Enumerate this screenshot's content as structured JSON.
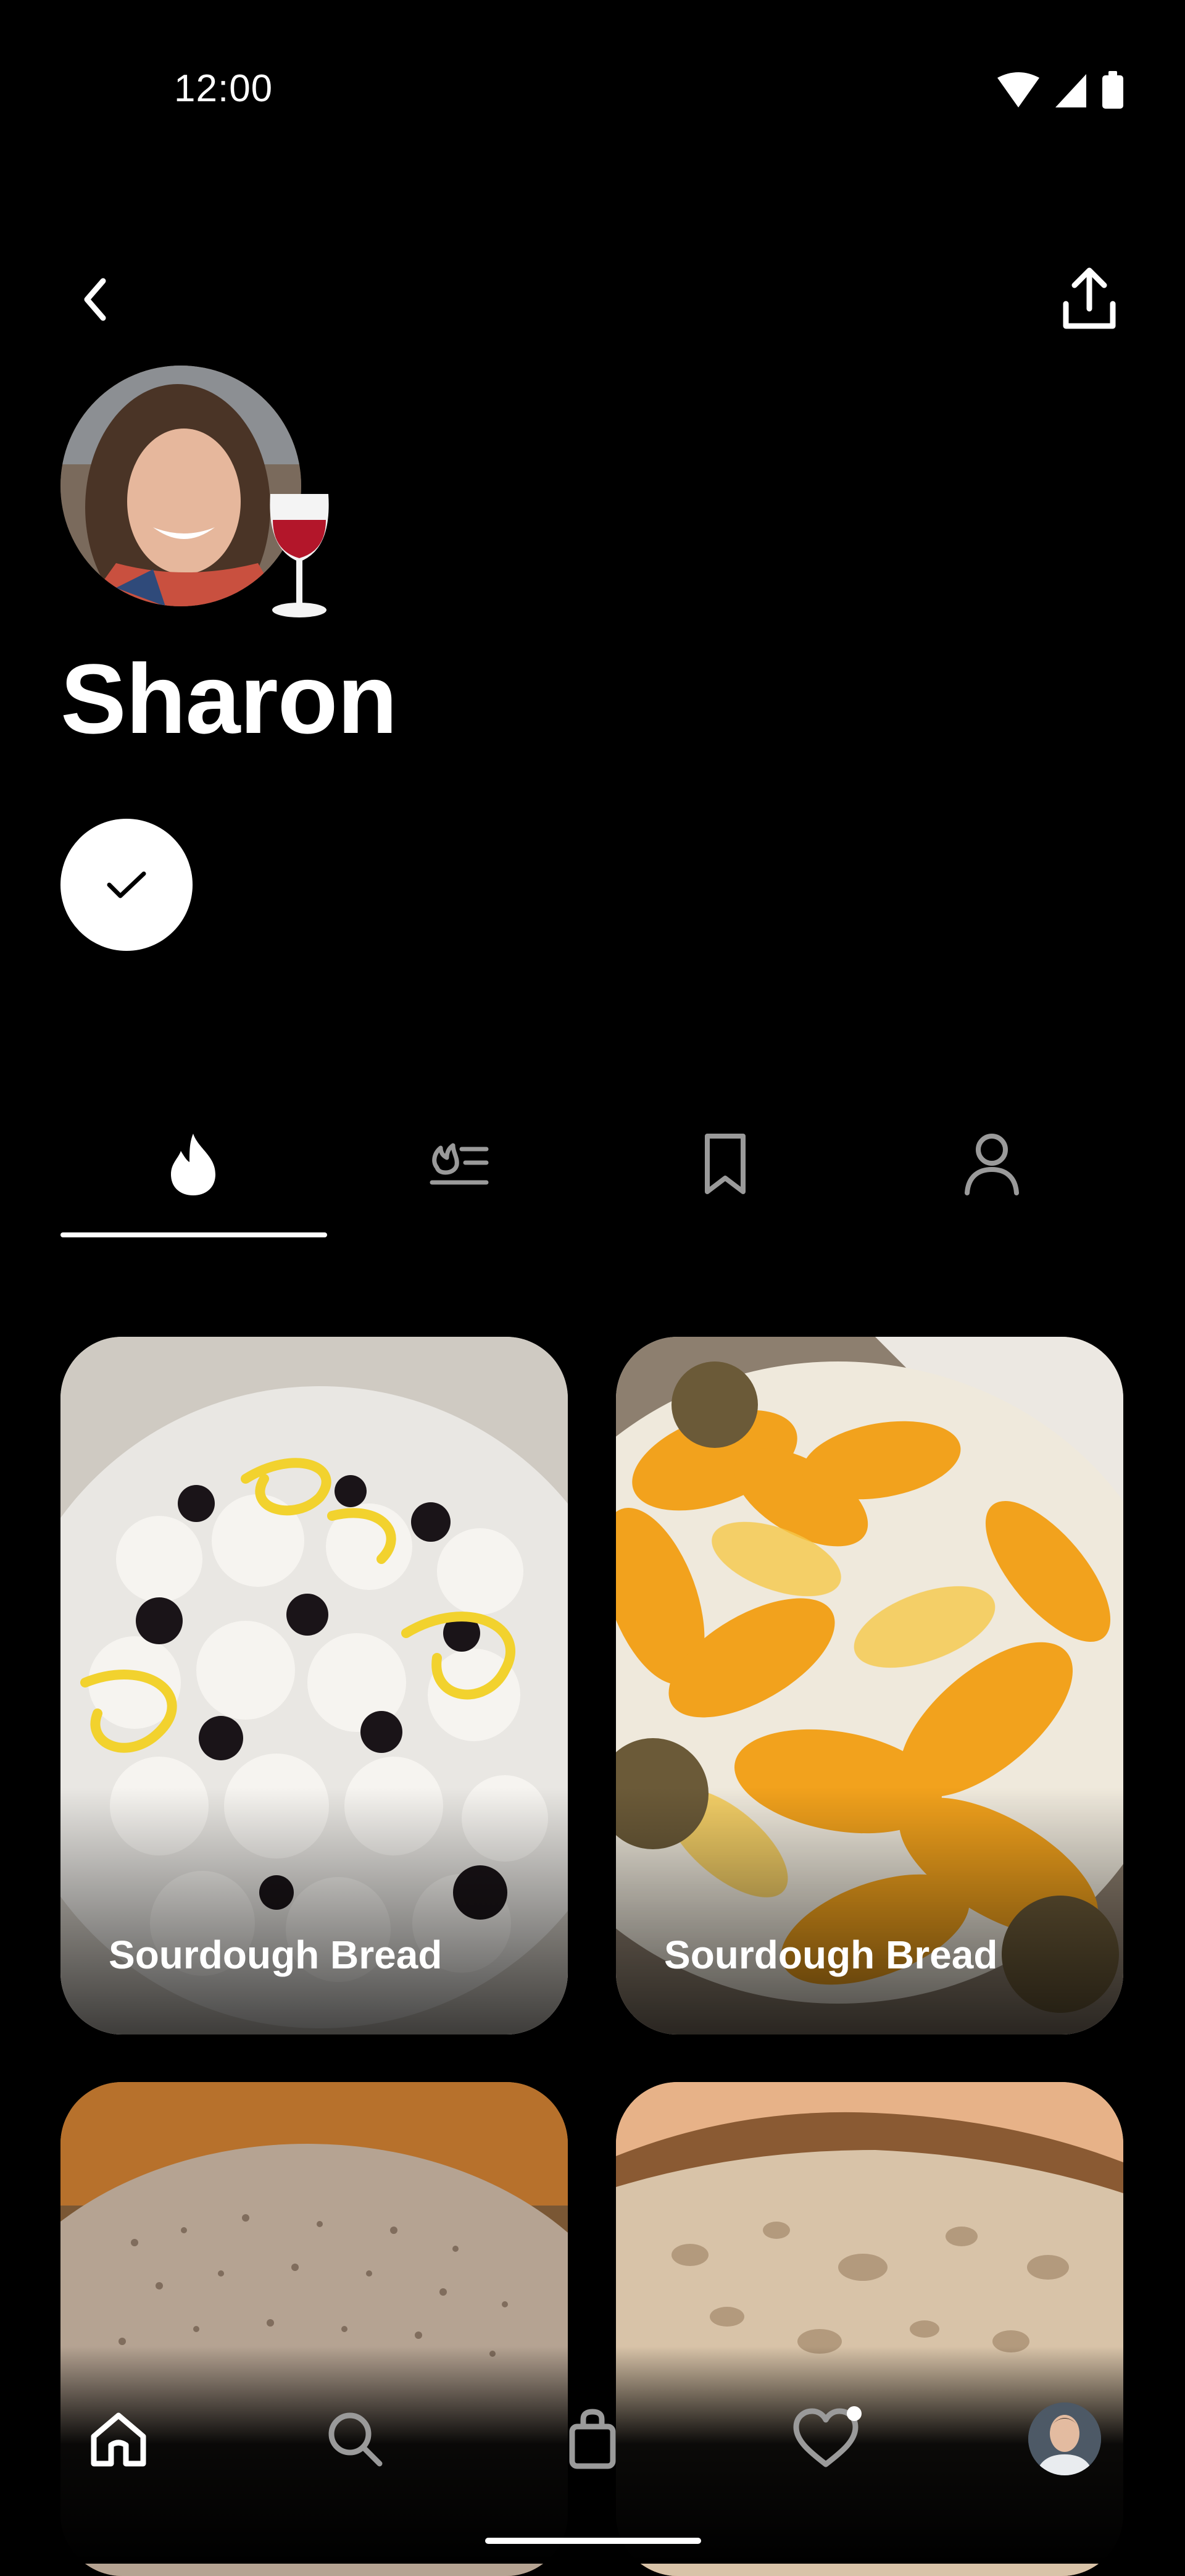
{
  "status_bar": {
    "time": "12:00"
  },
  "profile": {
    "name": "Sharon"
  },
  "tabs": [
    {
      "icon": "flame-icon"
    },
    {
      "icon": "recipes-list-icon"
    },
    {
      "icon": "bookmark-icon"
    },
    {
      "icon": "person-icon"
    }
  ],
  "grid": {
    "items": [
      {
        "title": "Sourdough Bread"
      },
      {
        "title": "Sourdough Bread"
      },
      {
        "title": ""
      },
      {
        "title": ""
      }
    ]
  },
  "bottom_nav": {
    "items": [
      {
        "icon": "home-icon"
      },
      {
        "icon": "search-icon"
      },
      {
        "icon": "shopping-bag-icon"
      },
      {
        "icon": "heart-icon"
      },
      {
        "icon": "profile-avatar"
      }
    ]
  },
  "colors": {
    "background": "#000000",
    "foreground": "#ffffff",
    "inactive": "#9a9a9a"
  }
}
